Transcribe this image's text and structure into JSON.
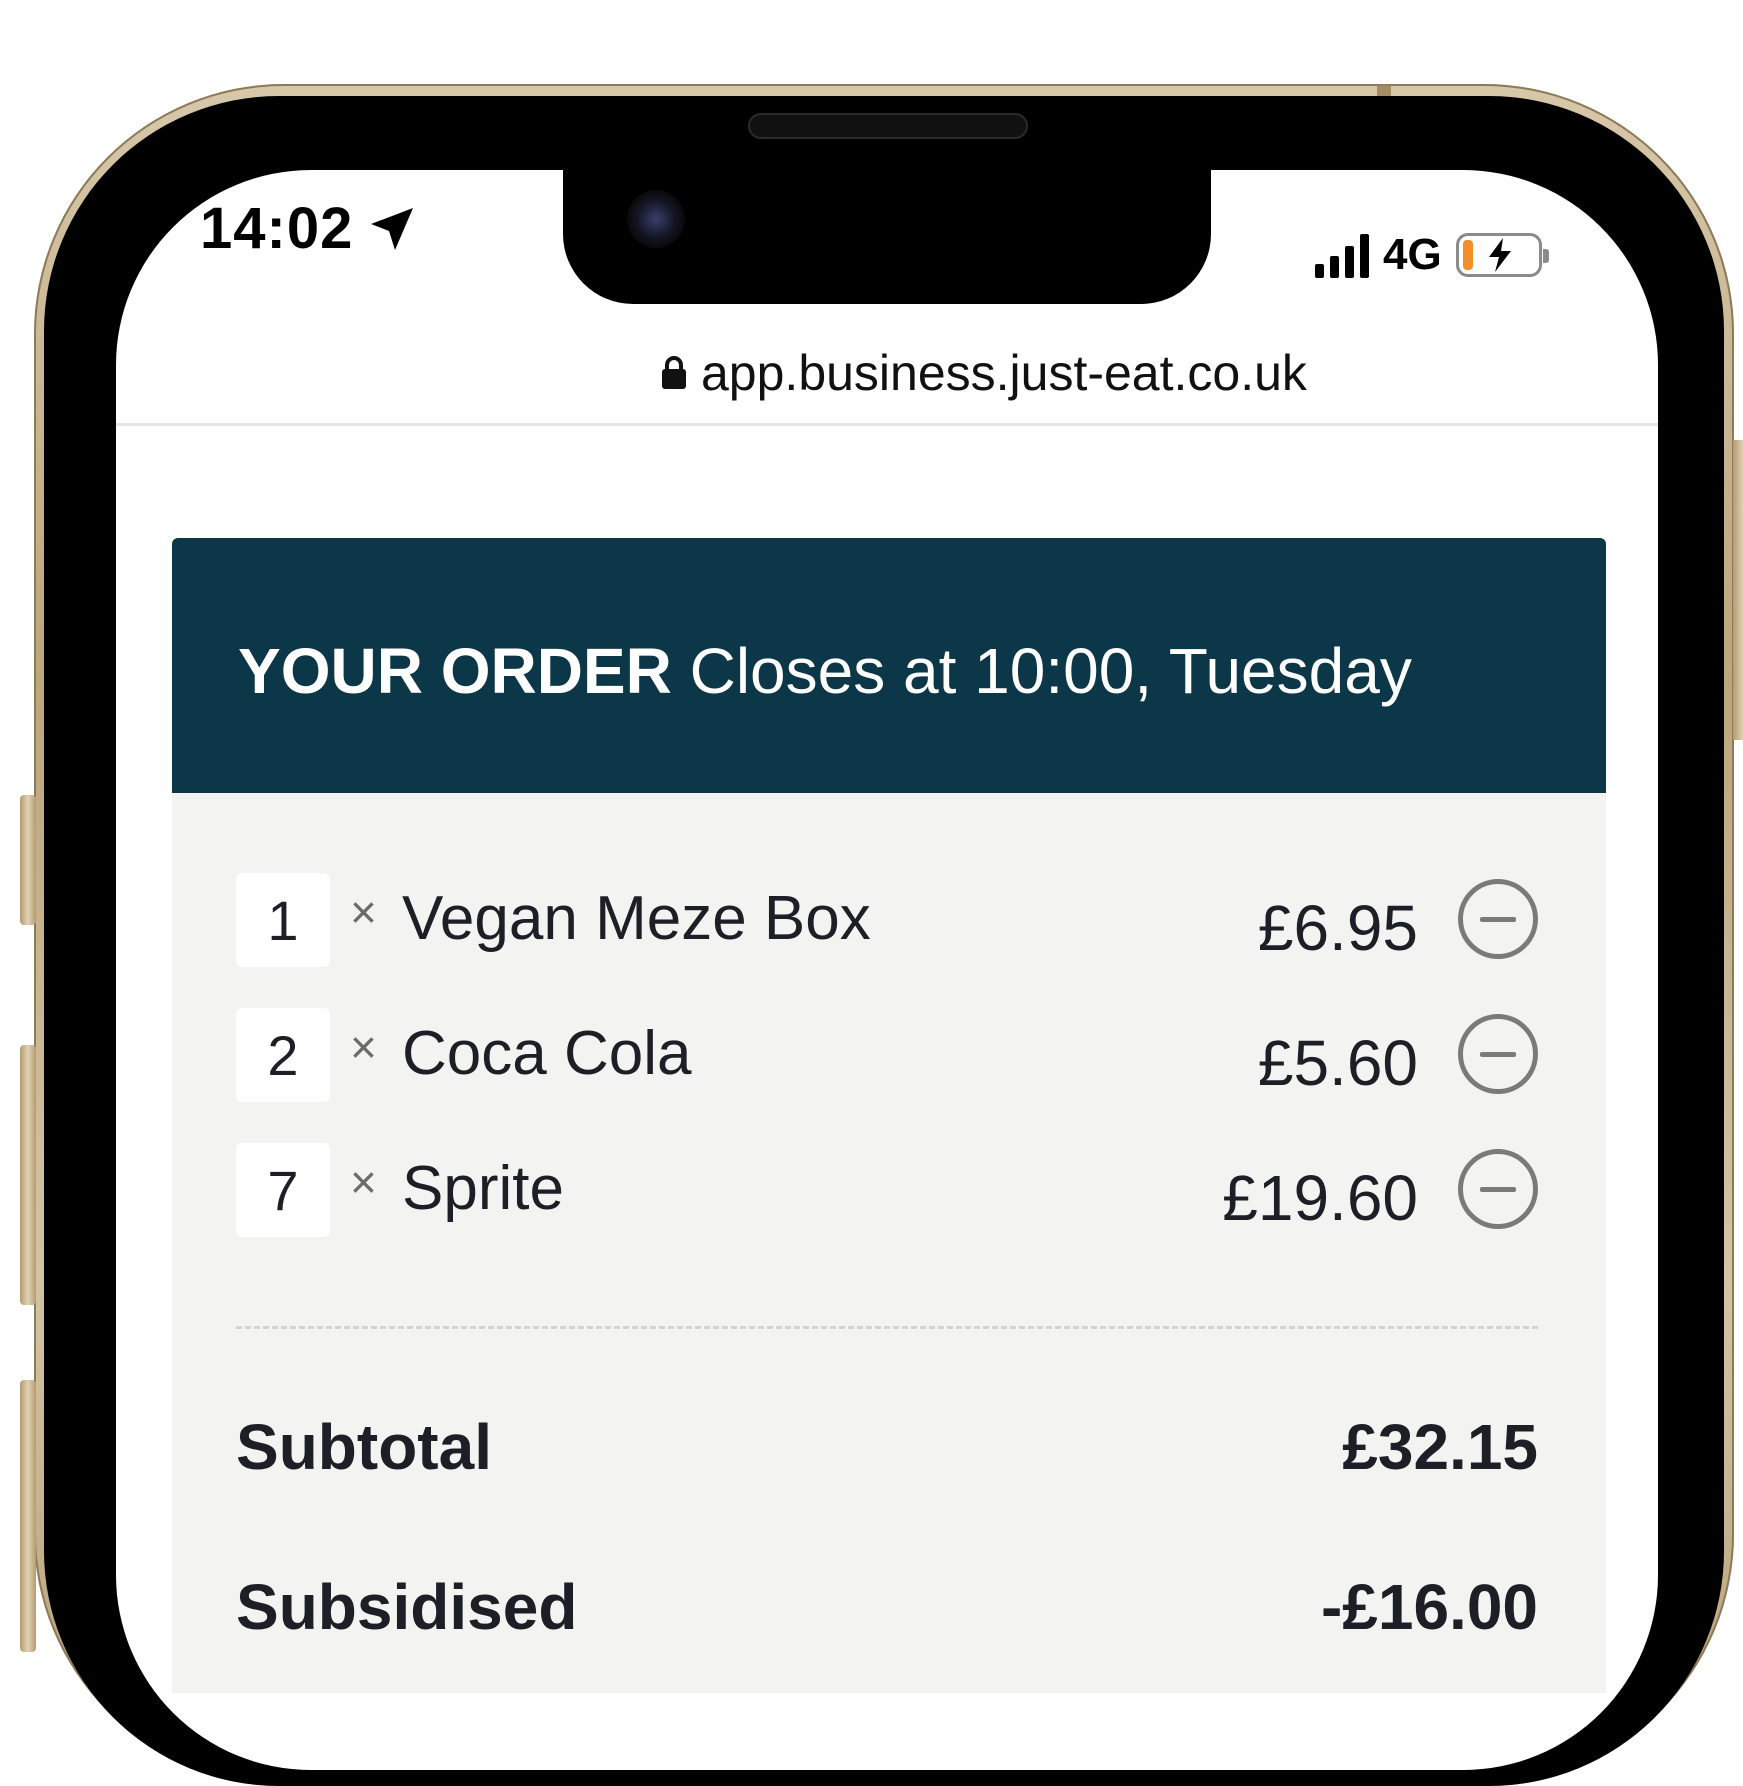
{
  "status_bar": {
    "time": "14:02",
    "network": "4G",
    "icons": [
      "location-arrow-icon",
      "cellular-signal-icon",
      "battery-charging-icon"
    ],
    "battery_color": "#f28f2b"
  },
  "browser": {
    "url": "app.business.just-eat.co.uk",
    "icon": "lock-icon"
  },
  "order": {
    "title": "YOUR ORDER",
    "subtitle": "Closes at 10:00, Tuesday",
    "header_color": "#0c3748",
    "items": [
      {
        "quantity": "1",
        "multiplier": "×",
        "name": "Vegan Meze Box",
        "price": "£6.95"
      },
      {
        "quantity": "2",
        "multiplier": "×",
        "name": "Coca Cola",
        "price": "£5.60"
      },
      {
        "quantity": "7",
        "multiplier": "×",
        "name": "Sprite",
        "price": "£19.60"
      }
    ],
    "summary": [
      {
        "label": "Subtotal",
        "value": "£32.15"
      },
      {
        "label": "Subsidised",
        "value": "-£16.00"
      }
    ]
  }
}
